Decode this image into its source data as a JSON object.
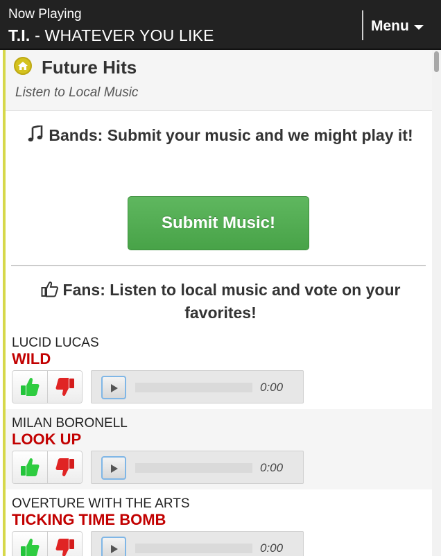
{
  "now_playing": {
    "label": "Now Playing",
    "artist": "T.I.",
    "separator": " - ",
    "title": "WHATEVER YOU LIKE"
  },
  "menu": {
    "label": "Menu"
  },
  "page": {
    "title": "Future Hits",
    "subtitle": "Listen to Local Music",
    "icon": "home-icon"
  },
  "bands": {
    "icon": "music-note-icon",
    "heading": "Bands: Submit your music and we might play it!",
    "button_label": "Submit Music!"
  },
  "fans": {
    "icon": "thumbs-up-icon",
    "heading": "Fans: Listen to local music and vote on your favorites!"
  },
  "tracks": [
    {
      "artist": "LUCID LUCAS",
      "title": "WILD",
      "time": "0:00"
    },
    {
      "artist": "MILAN BORONELL",
      "title": "LOOK UP",
      "time": "0:00"
    },
    {
      "artist": "OVERTURE WITH THE ARTS",
      "title": "TICKING TIME BOMB",
      "time": "0:00"
    }
  ],
  "colors": {
    "top_bar": "#222222",
    "accent_bar": "#d6d84a",
    "submit_green": "#4cae4c",
    "song_red": "#c20000",
    "thumb_up_green": "#2ecc40",
    "thumb_down_red": "#e02424"
  }
}
